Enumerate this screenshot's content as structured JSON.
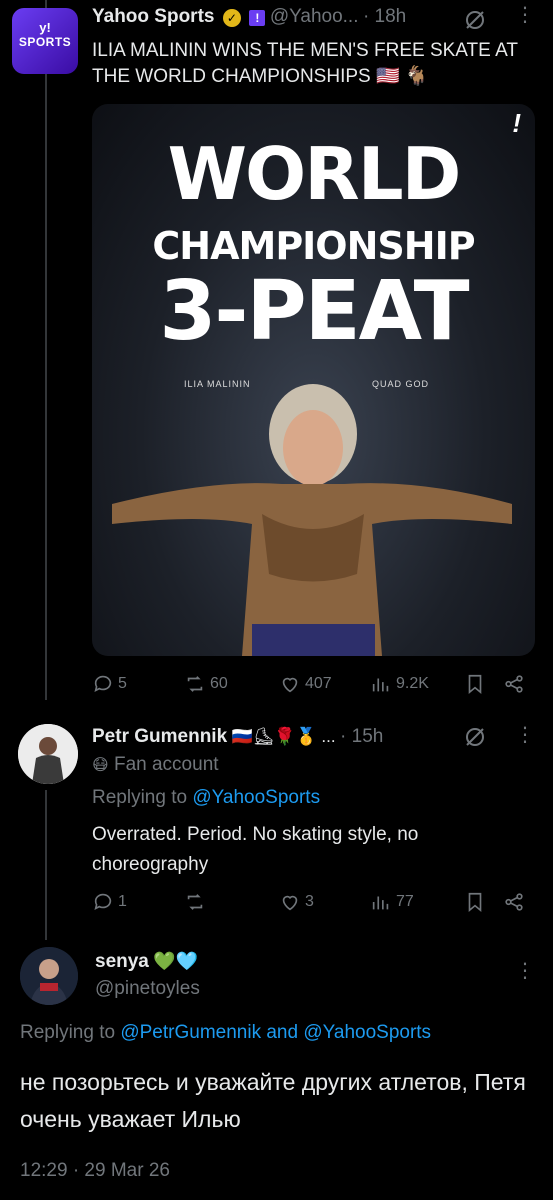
{
  "tweet1": {
    "avatar_line1": "y!",
    "avatar_line2": "SPORTS",
    "name": "Yahoo Sports",
    "handle": "@Yahoo...",
    "time": "· 18h",
    "text": "ILIA MALININ WINS THE MEN'S FREE SKATE AT THE WORLD CHAMPIONSHIPS 🇺🇸 🐐",
    "image": {
      "line1": "WORLD",
      "line2": "CHAMPIONSHIP",
      "line3": "3-PEAT",
      "left_label": "ILIA MALININ",
      "right_label": "QUAD GOD",
      "mark": "!"
    },
    "replies": "5",
    "reposts": "60",
    "likes": "407",
    "views": "9.2K"
  },
  "tweet2": {
    "name": "Petr Gumennik",
    "flags": "🇷🇺⛸🌹🥇 ...",
    "time": "· 15h",
    "account_label": "Fan account",
    "replying_prefix": "Replying to",
    "replying_to": "@YahooSports",
    "text": "Overrated. Period. No skating style, no choreography",
    "replies": "1",
    "reposts": "",
    "likes": "3",
    "views": "77"
  },
  "tweet3": {
    "name": "senya",
    "hearts": "💚🩵",
    "handle": "@pinetoyles",
    "replying_prefix": "Replying to",
    "replying_to": "@PetrGumennik and @YahooSports",
    "text": "не позорьтесь и уважайте других атлетов, Петя очень уважает Илью",
    "timestamp": "12:29 · 29 Mar 26"
  },
  "colors": {
    "accent": "#1d9bf0",
    "secondary": "#71767b",
    "text": "#e7e9ea",
    "background": "#000000"
  }
}
